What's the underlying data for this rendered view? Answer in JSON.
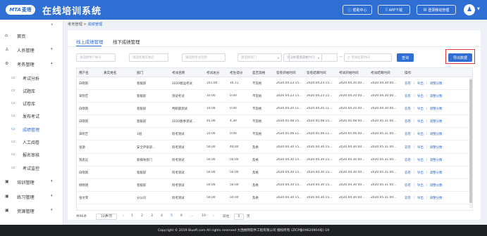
{
  "header": {
    "logo_mark": "MTA",
    "logo_text": "麦塔",
    "title": "在线培训系统",
    "buttons": [
      {
        "icon": "help-icon",
        "label": "帮助中心"
      },
      {
        "icon": "phone-icon",
        "label": "APP下载"
      },
      {
        "icon": "mobile-icon",
        "label": "登录移动管理"
      }
    ],
    "avatar_icon": "user-avatar-icon",
    "accent": "#2f6ed3"
  },
  "sidebar": {
    "collapse_icon": "chevron-left-icon",
    "items": [
      {
        "icon": "home-icon",
        "label": "首页"
      },
      {
        "icon": "user-icon",
        "label": "人员管理",
        "arrow": "chevron-down-icon"
      },
      {
        "icon": "exam-icon",
        "label": "考务管理",
        "arrow": "chevron-up-icon"
      },
      {
        "icon": "train-icon",
        "label": "培训管理",
        "arrow": "chevron-down-icon"
      },
      {
        "icon": "practice-icon",
        "label": "练习管理",
        "arrow": "chevron-down-icon"
      },
      {
        "icon": "resource-icon",
        "label": "资源管理",
        "arrow": "chevron-down-icon"
      }
    ],
    "sub_items": [
      {
        "icon": "analysis-icon",
        "label": "考试分析"
      },
      {
        "icon": "question-bank-icon",
        "label": "试题库"
      },
      {
        "icon": "paper-bank-icon",
        "label": "试卷库"
      },
      {
        "icon": "publish-icon",
        "label": "发布考试"
      },
      {
        "icon": "score-icon",
        "label": "成绩管理",
        "active": true
      },
      {
        "icon": "grading-icon",
        "label": "人工阅卷"
      },
      {
        "icon": "signup-icon",
        "label": "报名审核"
      },
      {
        "icon": "monitor-icon",
        "label": "考试监控"
      }
    ]
  },
  "breadcrumb": {
    "parent": "考务管理",
    "sep": ">",
    "current": "成绩管理"
  },
  "tabs": [
    {
      "label": "线上成绩管理",
      "active": true
    },
    {
      "label": "线下成绩管理",
      "active": false
    }
  ],
  "filters": {
    "username": "请选择用户账号",
    "realname": "请选择真实姓名",
    "exam_name": "请选择考试名称",
    "dept": "请选择部门",
    "pass_status": "请选择是否及格",
    "start_time": "考试开始时间",
    "range_sep": "—",
    "end_time": "考试结束时间",
    "search_label": "查询",
    "export_label": "导出数据"
  },
  "table": {
    "headers": [
      "用户名",
      "真实姓名",
      "部门",
      "考试名称",
      "考试总分",
      "考生得分",
      "是否及格",
      "答卷开始时间",
      "答卷结束时间",
      "考试开始时间",
      "考试结束时间",
      "操作"
    ],
    "rows": [
      [
        "白晓雨",
        "",
        "客服部",
        "2020春运考试",
        "101.00",
        "16.11",
        "不及格",
        "2020.04.23 15...",
        "2020.04.23 15...",
        "2020.04.30 00...",
        "2020.04.30 00..."
      ],
      [
        "宋明艺",
        "",
        "客服部",
        "测试考试",
        "10.00",
        "0.00",
        "不及格",
        "2020.04.23 15...",
        "2020.04.23 15...",
        "2020.04.20 00...",
        "2020.04.30 00..."
      ],
      [
        "白晓雨",
        "",
        "客服部",
        "判断题测试",
        "10.00",
        "0.00",
        "不及格",
        "2020.04.20 11...",
        "2020.04.20 11...",
        "2020.04.20 00...",
        "2020.04.30 00..."
      ],
      [
        "白晓雨",
        "",
        "客服部",
        "2020春季测试...",
        "45.00",
        "4.30",
        "不及格",
        "2020.05.08 15...",
        "2020.05.08 15...",
        "2020.05.08 00...",
        "2020.05.31 00..."
      ],
      [
        "宋明艺",
        "",
        "1组",
        "阿考测试",
        "10.00",
        "0.00",
        "不及格",
        "2020.05.06 11...",
        "2020.05.06 11...",
        "2020.05.06 00...",
        "2020.05.31 00..."
      ],
      [
        "张源",
        "",
        "安全环保部...",
        "阿考测试",
        "50.00",
        "40.00",
        "及格",
        "2020.04.30 15...",
        "2020.04.30 15...",
        "2020.04.30 00...",
        "2020.05.31 00..."
      ],
      [
        "钱思远",
        "",
        "新媒体部门",
        "阿考测试",
        "50.00",
        "50.00",
        "及格",
        "2020.04.30 15...",
        "2020.04.30 15...",
        "2020.04.30 00...",
        "2020.05.31 00..."
      ],
      [
        "白晓雨",
        "",
        "客服部",
        "阿考测试",
        "50.00",
        "50.00",
        "及格",
        "2020.04.30 15...",
        "2020.04.30 15...",
        "2020.04.30 00...",
        "2020.05.31 00..."
      ],
      [
        "杨晓明",
        "",
        "客服部",
        "阿考测试",
        "50.00",
        "50.00",
        "及格",
        "2020.04.30 15...",
        "2020.04.30 15...",
        "2020.04.30 00...",
        "2020.05.31 00..."
      ],
      [
        "张文琴",
        "",
        "分公司",
        "阿考测试",
        "50.00",
        "50.00",
        "及格",
        "2020.04.30 15...",
        "2020.04.30 15...",
        "2020.04.30 00...",
        "2020.05.31 00..."
      ]
    ],
    "actions": [
      "答卷",
      "导出",
      "调整分数"
    ],
    "action_sep": "|"
  },
  "pagination": {
    "total": "共96条",
    "page_size": "10条/页",
    "pages": [
      "1",
      "2",
      "3",
      "4",
      "5",
      "6",
      "...",
      "10"
    ],
    "prev_icon": "chevron-left-icon",
    "next_icon": "chevron-right-icon",
    "goto_label": "前往",
    "goto_value": "5",
    "page_unit": "页"
  },
  "footer": {
    "text": "Copyright © 2019 8iuoft.com All rights reserved 大连格网软件工程有限公司 版权所有 (ZICP备09620904号)-19"
  }
}
